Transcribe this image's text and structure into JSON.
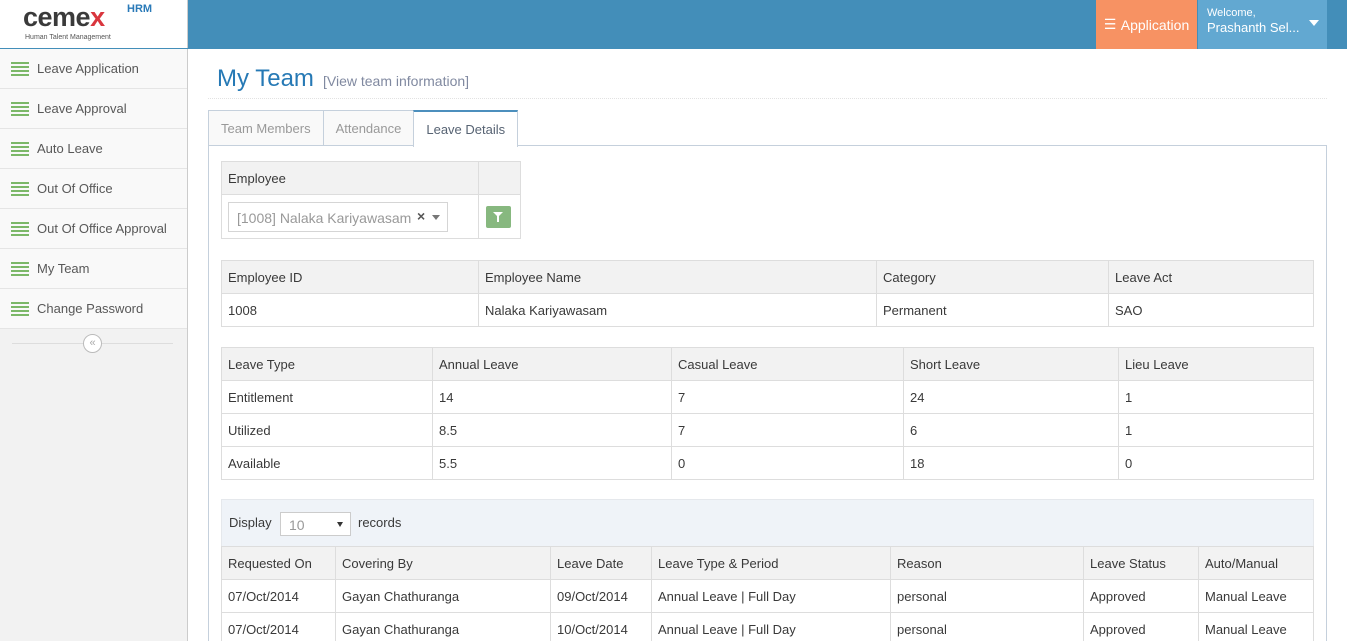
{
  "brand": {
    "logo_text": "cemex",
    "logo_suffix": "HRM",
    "tagline": "Human Talent Management"
  },
  "topbar": {
    "app_button": "Application",
    "welcome": "Welcome,",
    "user_name": "Prashanth Sel..."
  },
  "sidebar": {
    "items": [
      {
        "label": "Leave Application"
      },
      {
        "label": "Leave Approval"
      },
      {
        "label": "Auto Leave"
      },
      {
        "label": "Out Of Office"
      },
      {
        "label": "Out Of Office Approval"
      },
      {
        "label": "My Team"
      },
      {
        "label": "Change Password"
      }
    ],
    "collapse_glyph": "«"
  },
  "header": {
    "title": "My Team",
    "subtitle": "[View team information]"
  },
  "tabs": [
    {
      "label": "Team Members"
    },
    {
      "label": "Attendance"
    },
    {
      "label": "Leave Details"
    }
  ],
  "employee_filter": {
    "header": "Employee",
    "selected": "[1008] Nalaka Kariyawasam",
    "clear_glyph": "×"
  },
  "employee_info": {
    "headers": [
      "Employee ID",
      "Employee Name",
      "Category",
      "Leave Act"
    ],
    "row": [
      "1008",
      "Nalaka Kariyawasam",
      "Permanent",
      "SAO"
    ]
  },
  "leave_summary": {
    "headers": [
      "Leave Type",
      "Annual Leave",
      "Casual Leave",
      "Short Leave",
      "Lieu Leave"
    ],
    "rows": [
      [
        "Entitlement",
        "14",
        "7",
        "24",
        "1"
      ],
      [
        "Utilized",
        "8.5",
        "7",
        "6",
        "1"
      ],
      [
        "Available",
        "5.5",
        "0",
        "18",
        "0"
      ]
    ]
  },
  "records": {
    "display_label": "Display",
    "page_size": "10",
    "records_label": "records"
  },
  "requests": {
    "headers": [
      "Requested On",
      "Covering By",
      "Leave Date",
      "Leave Type & Period",
      "Reason",
      "Leave Status",
      "Auto/Manual"
    ],
    "rows": [
      [
        "07/Oct/2014",
        "Gayan Chathuranga",
        "09/Oct/2014",
        "Annual Leave | Full Day",
        "personal",
        "Approved",
        "Manual Leave"
      ],
      [
        "07/Oct/2014",
        "Gayan Chathuranga",
        "10/Oct/2014",
        "Annual Leave | Full Day",
        "personal",
        "Approved",
        "Manual Leave"
      ]
    ]
  }
}
